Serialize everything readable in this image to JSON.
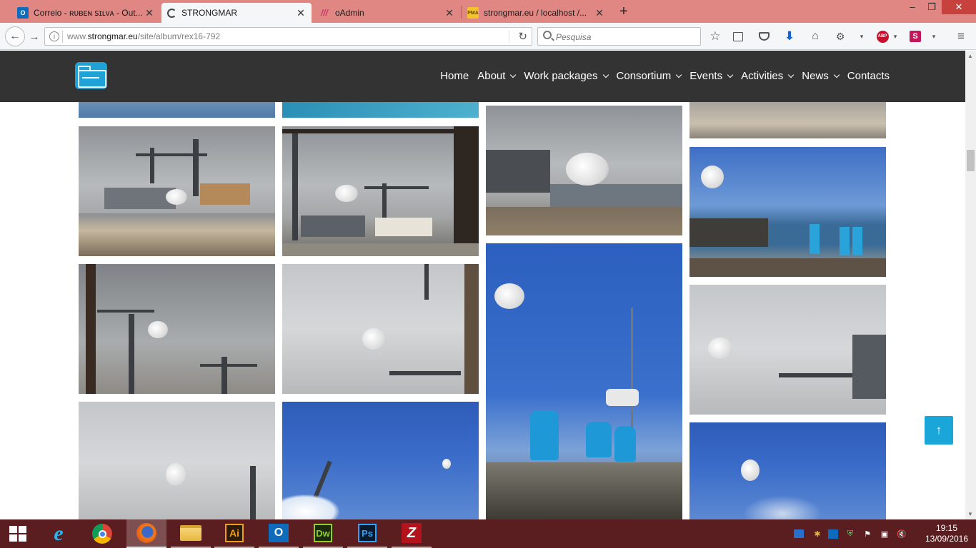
{
  "browser": {
    "tabs": [
      {
        "title": "Correio - ʀᴜʙᴇɴ ꜱɪʟᴠᴀ - Out...",
        "icon": "outlook-icon",
        "active": false
      },
      {
        "title": "STRONGMAR",
        "icon": "loading-spinner-icon",
        "active": true
      },
      {
        "title": "oAdmin",
        "icon": "oadmin-stripes-icon",
        "active": false
      },
      {
        "title": "strongmar.eu / localhost /...",
        "icon": "phpmyadmin-icon",
        "active": false
      }
    ],
    "url_prefix": "www.",
    "url_domain": "strongmar.eu",
    "url_path": "/site/album/rex16-792",
    "search_placeholder": "Pesquisa",
    "abp_label": "ABP",
    "s_ext_label": "S"
  },
  "site": {
    "menu": [
      {
        "label": "Home",
        "dropdown": false
      },
      {
        "label": "About",
        "dropdown": true
      },
      {
        "label": "Work packages",
        "dropdown": true
      },
      {
        "label": "Consortium",
        "dropdown": true
      },
      {
        "label": "Events",
        "dropdown": true
      },
      {
        "label": "Activities",
        "dropdown": true
      },
      {
        "label": "News",
        "dropdown": true
      },
      {
        "label": "Contacts",
        "dropdown": false
      }
    ],
    "back_to_top": "↑"
  },
  "taskbar": {
    "apps": [
      {
        "name": "internet-explorer",
        "label": "e"
      },
      {
        "name": "chrome",
        "label": ""
      },
      {
        "name": "firefox",
        "label": ""
      },
      {
        "name": "file-explorer",
        "label": ""
      },
      {
        "name": "illustrator",
        "label": "Ai"
      },
      {
        "name": "outlook",
        "label": "O"
      },
      {
        "name": "dreamweaver",
        "label": "Dw"
      },
      {
        "name": "photoshop",
        "label": "Ps"
      },
      {
        "name": "filezilla",
        "label": "Z"
      }
    ],
    "time": "19:15",
    "date": "13/09/2016"
  },
  "colors": {
    "tab_bar": "#e08784",
    "site_header": "#333333",
    "accent": "#1aa6d9",
    "taskbar": "#5a1e21"
  }
}
